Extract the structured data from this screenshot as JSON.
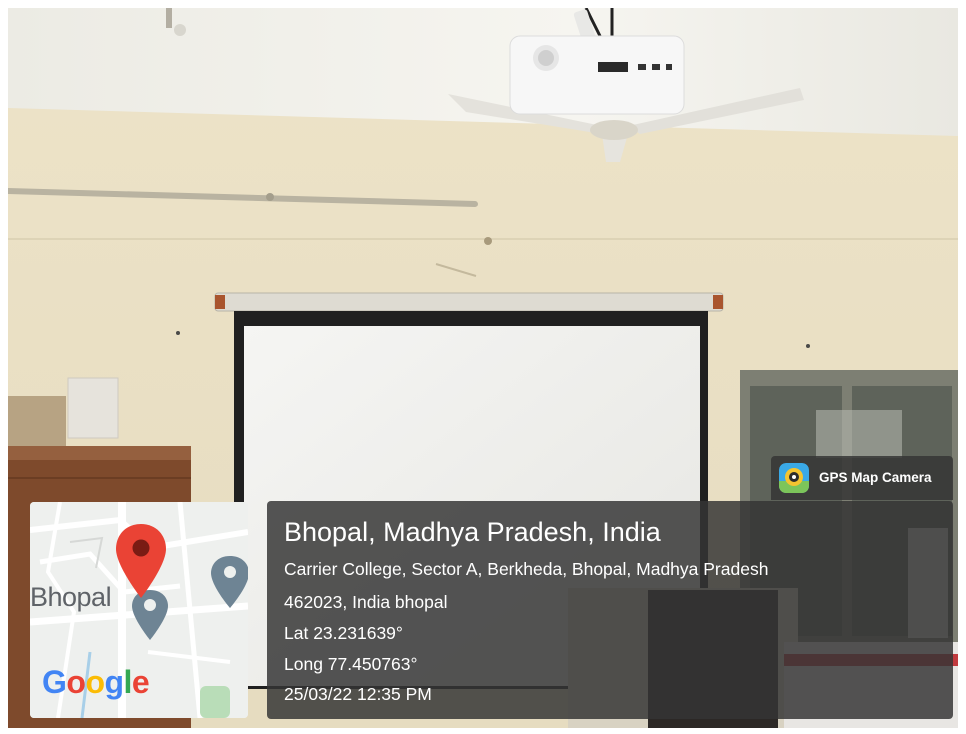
{
  "location": {
    "title": "Bhopal, Madhya Pradesh, India",
    "address_line1": "Carrier College, Sector A, Berkheda, Bhopal, Madhya Pradesh",
    "address_line2": "462023, India bhopal",
    "latitude": "Lat 23.231639°",
    "longitude": "Long 77.450763°",
    "timestamp": "25/03/22 12:35 PM"
  },
  "app_badge": {
    "icon": "gps-map-camera-icon",
    "label": "GPS Map Camera"
  },
  "map": {
    "city_label": "Bhopal",
    "logo_letters": [
      "G",
      "o",
      "o",
      "g",
      "l",
      "e"
    ],
    "logo_colors": [
      "#4285F4",
      "#EA4335",
      "#FBBC05",
      "#4285F4",
      "#34A853",
      "#EA4335"
    ],
    "marker_icon": "map-pin-icon",
    "marker_color": "#EA4335",
    "secondary_marker_icon": "place-pin-icon",
    "secondary_marker_color": "#6E8494"
  },
  "scene": {
    "wall_color": "#EDE3C8",
    "ceiling_color": "#F4F3EE",
    "screen_color": "#F4F4F2"
  }
}
